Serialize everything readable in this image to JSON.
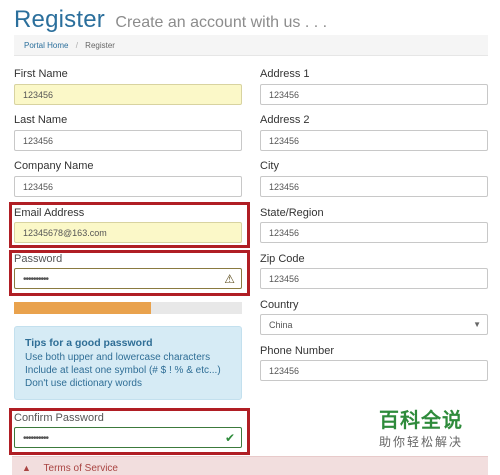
{
  "header": {
    "title": "Register",
    "subtitle": "Create an account with us . . ."
  },
  "breadcrumb": {
    "home": "Portal Home",
    "separator": "/",
    "current": "Register"
  },
  "left": {
    "first_name": {
      "label": "First Name",
      "value": "123456"
    },
    "last_name": {
      "label": "Last Name",
      "value": "123456"
    },
    "company_name": {
      "label": "Company Name",
      "value": "123456"
    },
    "email": {
      "label": "Email Address",
      "value": "12345678@163.com"
    },
    "password": {
      "label": "Password",
      "value": "••••••••••"
    },
    "password_strength": 0.6,
    "tips": {
      "title": "Tips for a good password",
      "lines": [
        "Use both upper and lowercase characters",
        "Include at least one symbol (# $ ! % & etc...)",
        "Don't use dictionary words"
      ]
    },
    "confirm_password": {
      "label": "Confirm Password",
      "value": "••••••••••"
    }
  },
  "right": {
    "address1": {
      "label": "Address 1",
      "value": "123456"
    },
    "address2": {
      "label": "Address 2",
      "value": "123456"
    },
    "city": {
      "label": "City",
      "value": "123456"
    },
    "state": {
      "label": "State/Region",
      "value": "123456"
    },
    "zip": {
      "label": "Zip Code",
      "value": "123456"
    },
    "country": {
      "label": "Country",
      "value": "China"
    },
    "phone": {
      "label": "Phone Number",
      "value": "123456"
    }
  },
  "terms": {
    "icon": "warning-icon",
    "label": "Terms of Service"
  },
  "watermark": {
    "main": "百科全说",
    "sub": "助你轻松解决"
  },
  "colors": {
    "accent": "#2b6f9c",
    "highlight_box": "#b01e24",
    "autofill_yellow": "#fbf8c8",
    "strength_bar": "#e9a24d",
    "tips_bg": "#d6ebf5",
    "terms_bg": "#f2dede"
  }
}
